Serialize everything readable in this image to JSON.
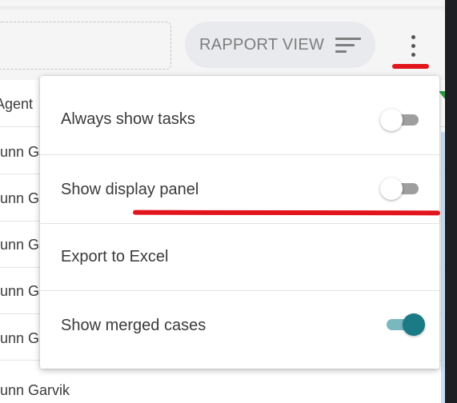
{
  "toolbar": {
    "rapport_view_label": "RAPPORT VIEW",
    "filter_icon": "filter-list-icon",
    "more_icon": "more-vert-icon"
  },
  "table": {
    "header": "Agent",
    "rows": [
      "unn Garvik",
      "unn Garvik",
      "unn Garvik",
      "unn Garvik",
      "unn Garvik",
      "unn Garvik"
    ]
  },
  "menu": {
    "items": [
      {
        "label": "Always show tasks",
        "toggle": false
      },
      {
        "label": "Show display panel",
        "toggle": false
      },
      {
        "label": "Export to Excel"
      },
      {
        "label": "Show merged cases",
        "toggle": true
      }
    ]
  },
  "colors": {
    "annotation": "#e2151d",
    "toggle_on": "#1a7a85",
    "toggle_off": "#9e9e9e"
  }
}
